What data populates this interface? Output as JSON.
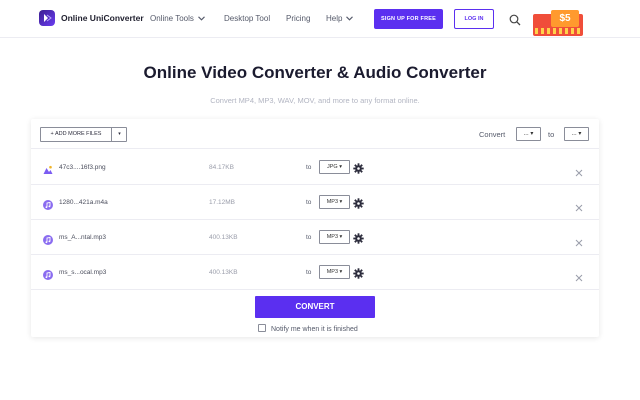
{
  "header": {
    "brand": "Online UniConverter",
    "nav": [
      {
        "label": "Online Tools",
        "has_dropdown": true
      },
      {
        "label": "Desktop Tool",
        "has_dropdown": false
      },
      {
        "label": "Pricing",
        "has_dropdown": false
      },
      {
        "label": "Help",
        "has_dropdown": true
      }
    ],
    "signup_label": "SIGN UP FOR FREE",
    "login_label": "LOG IN",
    "promo_label": "$5"
  },
  "hero": {
    "title": "Online Video Converter & Audio Converter",
    "subtitle": "Convert MP4, MP3, WAV, MOV, and more to any format online."
  },
  "toolbar": {
    "add_files_label": "+ ADD MORE FILES",
    "convert_label": "Convert",
    "from_value": "...",
    "to_label": "to",
    "to_value": "..."
  },
  "files": [
    {
      "name": "47c3....16f3.png",
      "size": "84.17KB",
      "to_label": "to",
      "format": "JPG",
      "type": "image"
    },
    {
      "name": "1280...421a.m4a",
      "size": "17.12MB",
      "to_label": "to",
      "format": "MP3",
      "type": "audio"
    },
    {
      "name": "ms_A...ntal.mp3",
      "size": "400.13KB",
      "to_label": "to",
      "format": "MP3",
      "type": "audio"
    },
    {
      "name": "ms_s...ocal.mp3",
      "size": "400.13KB",
      "to_label": "to",
      "format": "MP3",
      "type": "audio"
    }
  ],
  "actions": {
    "convert_label": "CONVERT",
    "notify_label": "Notify me when it is finished"
  },
  "colors": {
    "accent": "#5b2ff0",
    "image_icon": "#7b5cf2",
    "audio_icon": "#8a6cf0",
    "promo": "#f04e3a"
  },
  "icons": {
    "brand": "uniconverter-logo-icon",
    "search": "search-icon",
    "settings": "gear-icon",
    "remove": "close-icon"
  }
}
